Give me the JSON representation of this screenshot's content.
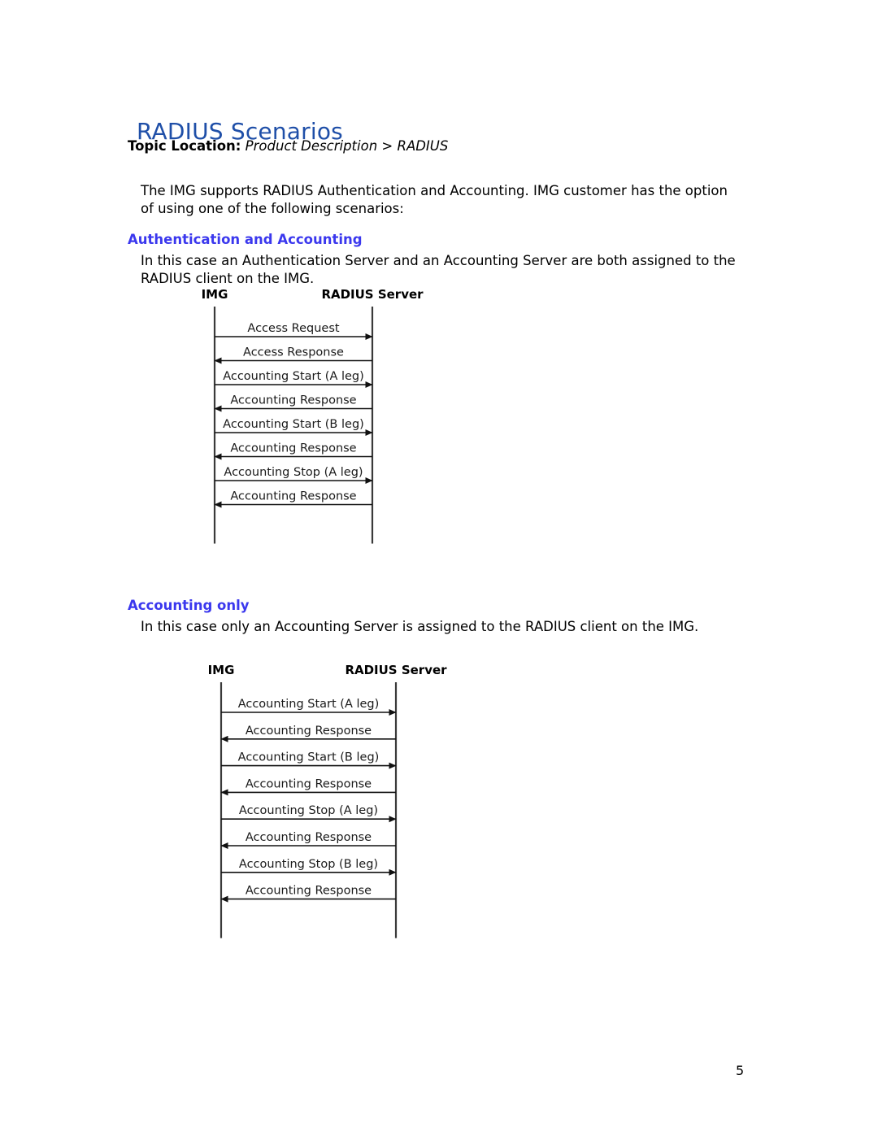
{
  "document": {
    "title": "RADIUS Scenarios",
    "title_color": "#1F4FA8",
    "heading_color": "#3B38EE",
    "page_number": "5"
  },
  "topic_location": {
    "label": "Topic Location:",
    "path": "Product Description > RADIUS"
  },
  "intro": {
    "paragraph": "The IMG supports RADIUS Authentication and Accounting. IMG customer has the option of using one of the following scenarios:"
  },
  "sections": [
    {
      "heading": "Authentication and Accounting",
      "paragraph": "In this case an Authentication Server and an Accounting Server are both assigned to the RADIUS client on the IMG.",
      "diagram": {
        "left_actor": "IMG",
        "right_actor": "RADIUS Server",
        "messages": [
          {
            "label": "Access Request",
            "direction": "right"
          },
          {
            "label": "Access Response",
            "direction": "left"
          },
          {
            "label": "Accounting Start (A leg)",
            "direction": "right"
          },
          {
            "label": "Accounting Response",
            "direction": "left"
          },
          {
            "label": "Accounting Start (B leg)",
            "direction": "right"
          },
          {
            "label": "Accounting Response",
            "direction": "left"
          },
          {
            "label": "Accounting Stop (A leg)",
            "direction": "right"
          },
          {
            "label": "Accounting Response",
            "direction": "left"
          }
        ]
      }
    },
    {
      "heading": "Accounting only",
      "paragraph": "In this case only an Accounting Server is assigned to the RADIUS client on the IMG.",
      "diagram": {
        "left_actor": "IMG",
        "right_actor": "RADIUS Server",
        "messages": [
          {
            "label": "Accounting Start (A leg)",
            "direction": "right"
          },
          {
            "label": "Accounting Response",
            "direction": "left"
          },
          {
            "label": "Accounting Start (B leg)",
            "direction": "right"
          },
          {
            "label": "Accounting Response",
            "direction": "left"
          },
          {
            "label": "Accounting Stop (A leg)",
            "direction": "right"
          },
          {
            "label": "Accounting Response",
            "direction": "left"
          },
          {
            "label": "Accounting Stop (B leg)",
            "direction": "right"
          },
          {
            "label": "Accounting Response",
            "direction": "left"
          }
        ]
      }
    }
  ]
}
